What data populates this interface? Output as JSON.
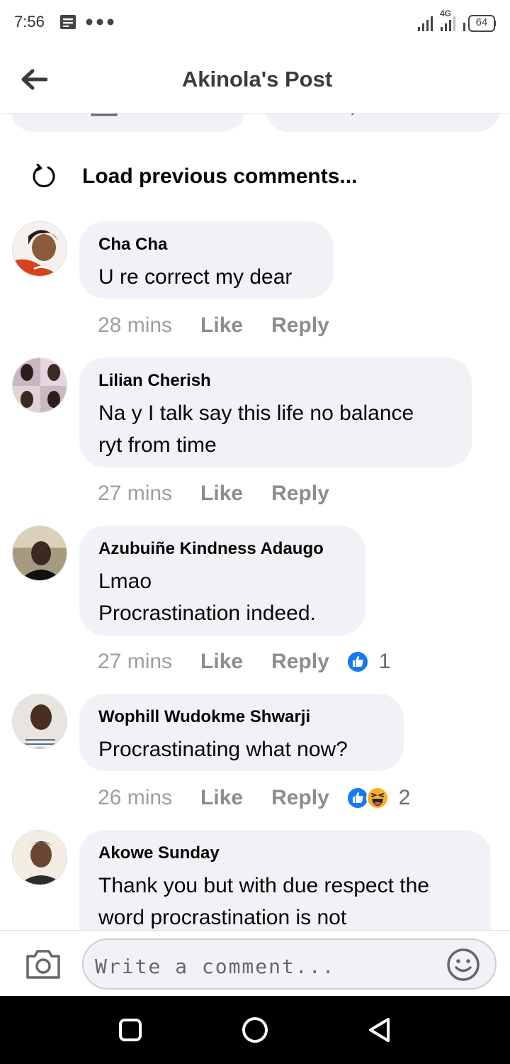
{
  "status_bar": {
    "time": "7:56",
    "network": "4G",
    "battery": "64",
    "icons": [
      "document-icon",
      "more-dots-icon",
      "signal-icon",
      "signal-4g-icon",
      "battery-icon"
    ]
  },
  "header": {
    "title": "Akinola's Post",
    "back_icon": "arrow-left-icon"
  },
  "load_previous": {
    "label": "Load previous comments...",
    "icon": "refresh-icon"
  },
  "comments": [
    {
      "author": "Cha Cha",
      "lines": [
        "U re correct my dear"
      ],
      "time": "28 mins",
      "like_label": "Like",
      "reply_label": "Reply",
      "reactions": [],
      "reaction_count": ""
    },
    {
      "author": "Lilian Cherish",
      "lines": [
        "Na y I talk say this life no balance",
        "ryt from time"
      ],
      "time": "27 mins",
      "like_label": "Like",
      "reply_label": "Reply",
      "reactions": [],
      "reaction_count": ""
    },
    {
      "author": "Azubuiñe Kindness Adaugo",
      "lines": [
        "Lmao",
        "Procrastination indeed."
      ],
      "time": "27 mins",
      "like_label": "Like",
      "reply_label": "Reply",
      "reactions": [
        "like-reaction-icon"
      ],
      "reaction_count": "1"
    },
    {
      "author": "Wophill Wudokme Shwarji",
      "lines": [
        "Procrastinating what now?"
      ],
      "time": "26 mins",
      "like_label": "Like",
      "reply_label": "Reply",
      "reactions": [
        "like-reaction-icon",
        "haha-reaction-icon"
      ],
      "reaction_count": "2"
    },
    {
      "author": "Akowe Sunday",
      "lines": [
        "Thank you but with due respect the",
        "word procrastination is not"
      ],
      "time": "",
      "like_label": "",
      "reply_label": "",
      "reactions": [],
      "reaction_count": ""
    }
  ],
  "composer": {
    "placeholder": "Write a comment...",
    "camera_icon": "camera-icon",
    "emoji_icon": "emoji-icon"
  },
  "navbar": {
    "icons": [
      "recent-apps-icon",
      "home-icon",
      "back-triangle-icon"
    ]
  },
  "colors": {
    "bubble": "#f0f2f5",
    "like_blue": "#1877f2",
    "haha_yellow": "#f7b125",
    "meta_gray": "#8a8d91"
  }
}
